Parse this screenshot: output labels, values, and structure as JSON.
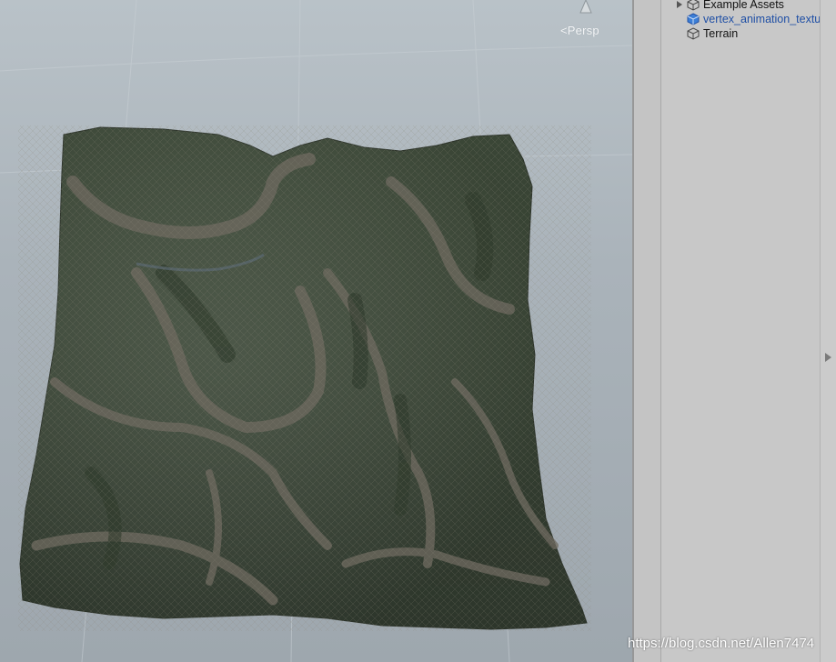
{
  "scene": {
    "camera_mode": "Persp",
    "terrain_object": "Terrain mesh"
  },
  "hierarchy": {
    "items": [
      {
        "label": "Example Assets",
        "icon": "cube-outline-icon",
        "expandable": true
      },
      {
        "label": "vertex_animation_textu",
        "icon": "prefab-cube-icon",
        "expandable": false
      },
      {
        "label": "Terrain",
        "icon": "cube-outline-icon",
        "expandable": false
      }
    ]
  },
  "watermark": "https://blog.csdn.net/Allen7474",
  "colors": {
    "scene_background": "#aab3ba",
    "panel_background": "#c8c8c8",
    "prefab_text": "#1f4fa5",
    "terrain_green": "#3f4f3a",
    "terrain_path": "#6f6a60"
  }
}
